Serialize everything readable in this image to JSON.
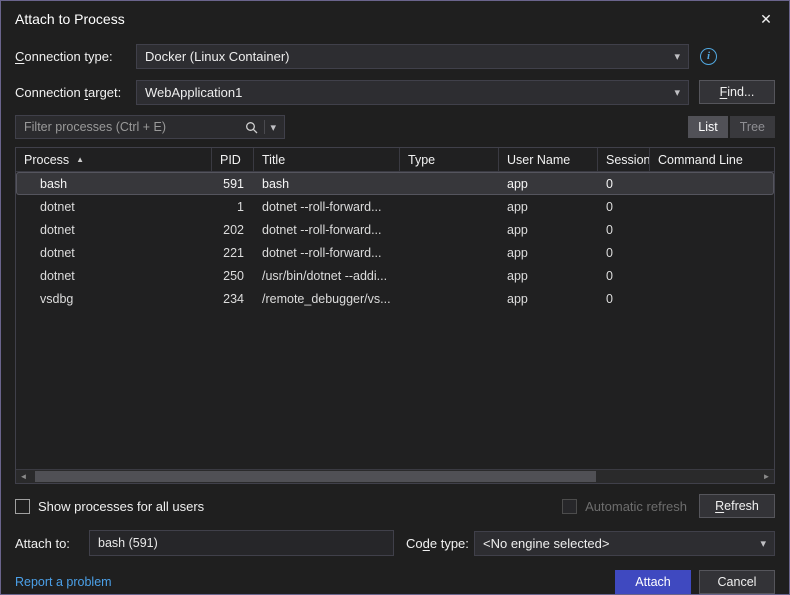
{
  "window": {
    "title": "Attach to Process",
    "close_icon": "✕"
  },
  "icons": {
    "chevron": "▾",
    "sort_ascending": "▲",
    "scroll_left": "◄",
    "scroll_right": "►",
    "info": "i"
  },
  "connection_type": {
    "label_u": "C",
    "label_rest": "onnection type:",
    "value": "Docker (Linux Container)"
  },
  "connection_target": {
    "label_pre": "Connection ",
    "label_u": "t",
    "label_rest": "arget:",
    "value": "WebApplication1",
    "find_u": "F",
    "find_rest": "ind..."
  },
  "filter": {
    "placeholder": "Filter processes (Ctrl + E)"
  },
  "view": {
    "list": "List",
    "tree": "Tree"
  },
  "table": {
    "columns": [
      "Process",
      "PID",
      "Title",
      "Type",
      "User Name",
      "Session",
      "Command Line"
    ],
    "rows": [
      {
        "process": "bash",
        "pid": "591",
        "title": "bash",
        "type": "",
        "user": "app",
        "session": "0",
        "cmd": ""
      },
      {
        "process": "dotnet",
        "pid": "1",
        "title": "dotnet --roll-forward...",
        "type": "",
        "user": "app",
        "session": "0",
        "cmd": ""
      },
      {
        "process": "dotnet",
        "pid": "202",
        "title": "dotnet --roll-forward...",
        "type": "",
        "user": "app",
        "session": "0",
        "cmd": ""
      },
      {
        "process": "dotnet",
        "pid": "221",
        "title": "dotnet --roll-forward...",
        "type": "",
        "user": "app",
        "session": "0",
        "cmd": ""
      },
      {
        "process": "dotnet",
        "pid": "250",
        "title": "/usr/bin/dotnet --addi...",
        "type": "",
        "user": "app",
        "session": "0",
        "cmd": ""
      },
      {
        "process": "vsdbg",
        "pid": "234",
        "title": "/remote_debugger/vs...",
        "type": "",
        "user": "app",
        "session": "0",
        "cmd": ""
      }
    ],
    "selected_row_process": "bash"
  },
  "options": {
    "show_all_users": "Show processes for all users",
    "auto_refresh": "Automatic refresh",
    "refresh_u": "R",
    "refresh_rest": "efresh"
  },
  "attach_to": {
    "label": "Attach to:",
    "value": "bash (591)"
  },
  "code_type": {
    "label_pre": "Co",
    "label_u": "d",
    "label_rest": "e type:",
    "value": "<No engine selected>"
  },
  "footer": {
    "report_link": "Report a problem",
    "attach": "Attach",
    "cancel": "Cancel"
  },
  "colors": {
    "dialog_background": "#1f1f1f",
    "dialog_border": "#6a648c",
    "control_background": "#2d2d31",
    "control_border": "#40404a",
    "selected_row": "#37373b",
    "accent_button": "#3f49c0",
    "link": "#4ba0e8",
    "info_icon": "#51a8e0",
    "disabled_text": "#6d6d6d"
  }
}
